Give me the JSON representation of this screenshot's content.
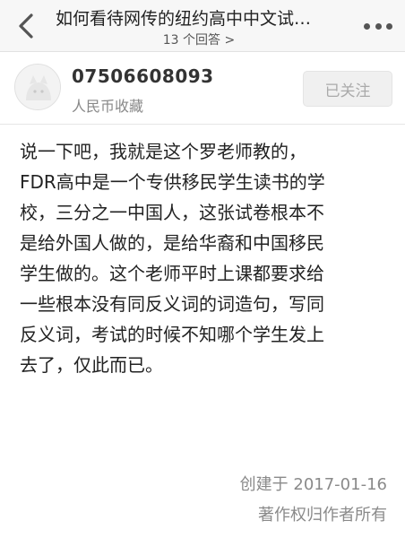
{
  "header": {
    "title": "如何看待网传的纽约高中中文试…",
    "subtitle": "13 个回答 >"
  },
  "author": {
    "name": "07506608093",
    "bio": "人民币收藏",
    "follow_label": "已关注"
  },
  "answer": {
    "lines": [
      "说一下吧，我就是这个罗老师教的，",
      "FDR高中是一个专供移民学生读书的学",
      "校，三分之一中国人，这张试卷根本不",
      "是给外国人做的，是给华裔和中国移民",
      "学生做的。这个老师平时上课都要求给",
      "一些根本没有同反义词的词造句，写同",
      "反义词，考试的时候不知哪个学生发上",
      "去了，仅此而已。"
    ]
  },
  "footer": {
    "created": "创建于 2017-01-16",
    "copyright": "著作权归作者所有"
  },
  "icons": {
    "back": "chevron-left-icon",
    "more": "more-dots-icon",
    "avatar": "default-avatar-icon"
  }
}
